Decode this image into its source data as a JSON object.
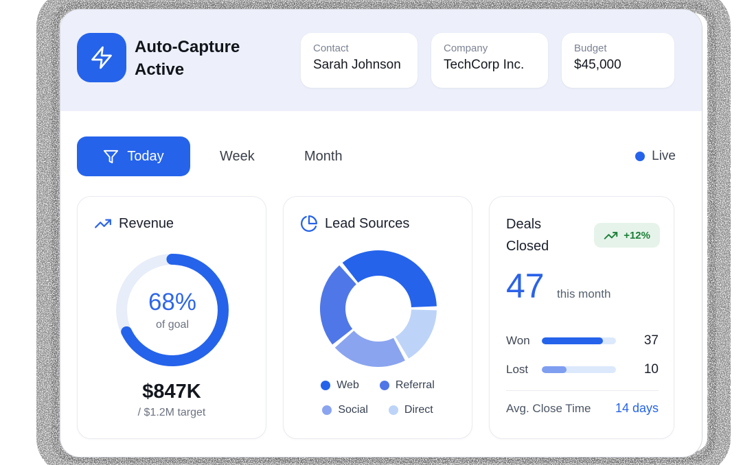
{
  "colors": {
    "primary_blue": "#2563eb",
    "header_band": "#edf0fa",
    "ring_track": "#e7edf9",
    "bar_track": "#dce9fc",
    "badge_green_bg": "#e6f3ea",
    "badge_green_text": "#1a7f37"
  },
  "header": {
    "app_title": "Auto-Capture Active",
    "chips": [
      {
        "label": "Contact",
        "value": "Sarah Johnson"
      },
      {
        "label": "Company",
        "value": "TechCorp Inc."
      },
      {
        "label": "Budget",
        "value": "$45,000"
      }
    ]
  },
  "filters": {
    "tabs": [
      "Today",
      "Week",
      "Month"
    ],
    "active_tab": "Today",
    "live_label": "Live"
  },
  "cards": {
    "revenue": {
      "title": "Revenue",
      "amount": "$847K",
      "target": "/ $1.2M target"
    },
    "lead_sources": {
      "title": "Lead Sources"
    },
    "deals": {
      "title": "Deals Closed",
      "badge": "+12%",
      "big_number": "47",
      "big_suffix": "this month",
      "footer_label": "Avg. Close Time",
      "footer_value": "14 days"
    }
  },
  "chart_data": [
    {
      "id": "revenue-ring",
      "type": "donut-progress",
      "percent": 68,
      "label": "68%",
      "sublabel": "of goal",
      "value": "$847K",
      "target": "$1.2M",
      "arc_color": "#2563eb",
      "track_color": "#e7edf9"
    },
    {
      "id": "lead-sources-donut",
      "type": "pie",
      "title": "Lead Sources",
      "segments": [
        {
          "label": "Web",
          "pct": 36,
          "color": "#2563eb"
        },
        {
          "label": "Referral",
          "pct": 25,
          "color": "#5077e8"
        },
        {
          "label": "Social",
          "pct": 22,
          "color": "#8aa4ef"
        },
        {
          "label": "Direct",
          "pct": 17,
          "color": "#bdd4f8"
        }
      ],
      "rotation_deg": -40,
      "gap_deg": 4,
      "clockwise_order": [
        "Web",
        "Direct",
        "Social",
        "Referral"
      ],
      "inner_radius_ratio": 0.56,
      "legend_position": "bottom"
    },
    {
      "id": "deals-bars",
      "type": "bar",
      "rows": [
        {
          "label": "Won",
          "value": "37",
          "pct": 82,
          "color": "#2563eb"
        },
        {
          "label": "Lost",
          "value": "10",
          "pct": 33,
          "color": "#7f9ef0"
        }
      ],
      "track_color": "#dce9fc"
    }
  ]
}
